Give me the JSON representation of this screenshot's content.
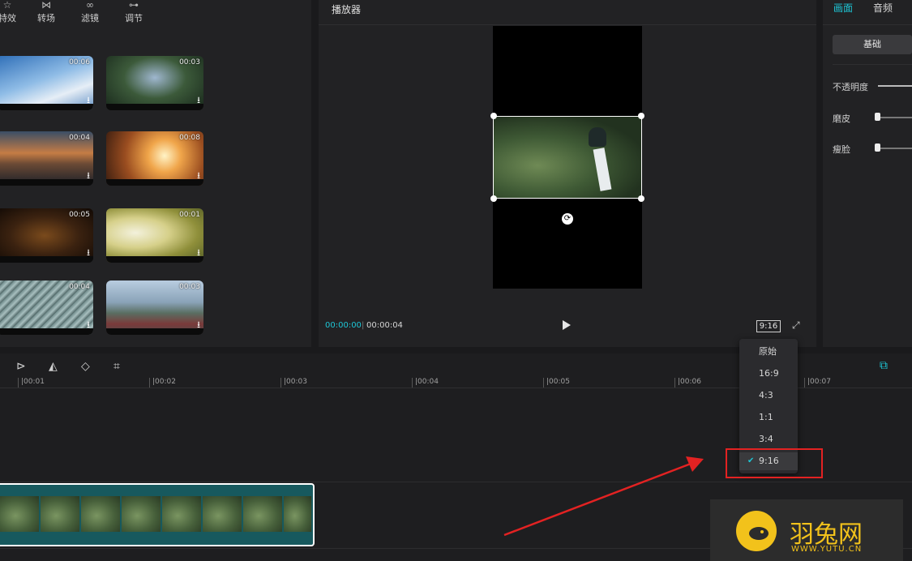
{
  "media_toolbar": {
    "items": [
      {
        "label": "特效",
        "icon": "effects-icon"
      },
      {
        "label": "转场",
        "icon": "transition-icon"
      },
      {
        "label": "滤镜",
        "icon": "filter-icon"
      },
      {
        "label": "调节",
        "icon": "adjust-icon"
      }
    ]
  },
  "media_grid": [
    {
      "duration": "00:06"
    },
    {
      "duration": "00:03"
    },
    {
      "duration": "00:04"
    },
    {
      "duration": "00:08"
    },
    {
      "duration": "00:05"
    },
    {
      "duration": "00:01"
    },
    {
      "duration": "00:04"
    },
    {
      "duration": "00:03"
    }
  ],
  "player": {
    "title": "播放器",
    "current_time": "00:00:00",
    "separator": "|",
    "total_time": "00:00:04",
    "aspect_ratio": "9:16"
  },
  "inspector": {
    "tabs": [
      {
        "label": "画面",
        "active": true
      },
      {
        "label": "音频",
        "active": false
      }
    ],
    "basic_button": "基础",
    "opacity_label": "不透明度",
    "smooth_label": "磨皮",
    "slim_label": "瘦脸"
  },
  "timeline": {
    "ticks": [
      "|00:01",
      "|00:02",
      "|00:03",
      "|00:04",
      "|00:05",
      "|00:06",
      "|00:07"
    ]
  },
  "ratio_menu": {
    "options": [
      "原始",
      "16:9",
      "4:3",
      "1:1",
      "3:4",
      "9:16"
    ],
    "selected": "9:16"
  },
  "watermark": {
    "name": "羽兔网",
    "url": "WWW.YUTU.CN"
  },
  "colors": {
    "accent": "#1ec6d6",
    "highlight": "#e32222",
    "watermark": "#f2c21b"
  }
}
